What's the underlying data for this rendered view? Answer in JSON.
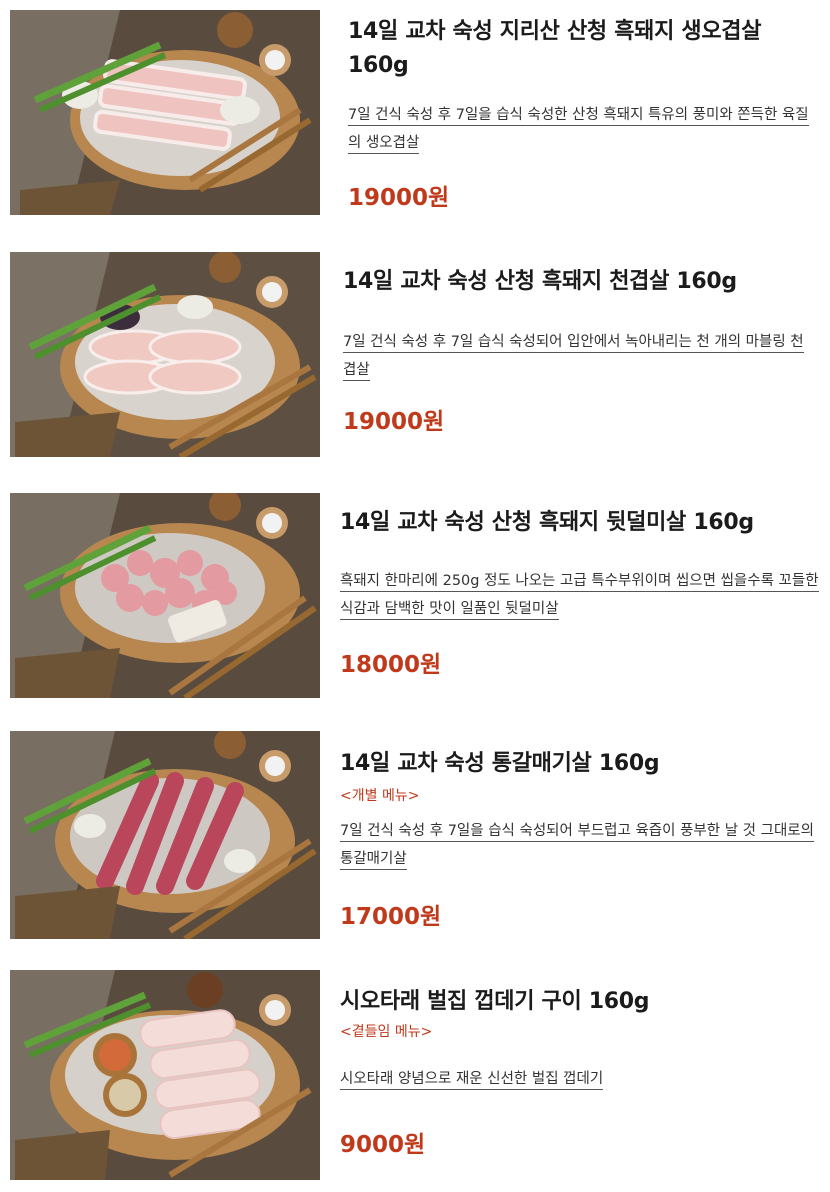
{
  "menu": {
    "items": [
      {
        "title": "14일 교차 숙성 지리산 산청 흑돼지 생오겹살 160g",
        "tag": "",
        "description": "7일 건식 숙성 후 7일을 습식 숙성한 산청 흑돼지 특유의 풍미와 쫀득한 육질의 생오겹살",
        "price": "19000원",
        "meat": "pork-belly-strips"
      },
      {
        "title": "14일 교차 숙성 산청 흑돼지 천겹살 160g",
        "tag": "",
        "description": "7일 건식 숙성 후 7일 습식 숙성되어 입안에서 녹아내리는 천 개의 마블링 천겹살",
        "price": "19000원",
        "meat": "thin-sliced-pork"
      },
      {
        "title": "14일 교차 숙성 산청 흑돼지 뒷덜미살 160g",
        "tag": "",
        "description": "흑돼지 한마리에 250g 정도 나오는 고급 특수부위이며 씹으면 씹을수록 꼬들한 식감과 담백한 맛이 일품인 뒷덜미살",
        "price": "18000원",
        "meat": "neck-meat-pieces"
      },
      {
        "title": "14일 교차 숙성 통갈매기살 160g",
        "tag": "<개별 메뉴>",
        "description": "7일 건식 숙성 후 7일을 습식 숙성되어 부드럽고 육즙이 풍부한 날 것 그대로의 통갈매기살",
        "price": "17000원",
        "meat": "skirt-meat-strips"
      },
      {
        "title": "시오타래 벌집 껍데기 구이 160g",
        "tag": "<곁들임 메뉴>",
        "description": "시오타래 양념으로 재운 신선한 벌집 껍데기",
        "price": "9000원",
        "meat": "pork-skin-rolls"
      }
    ]
  }
}
